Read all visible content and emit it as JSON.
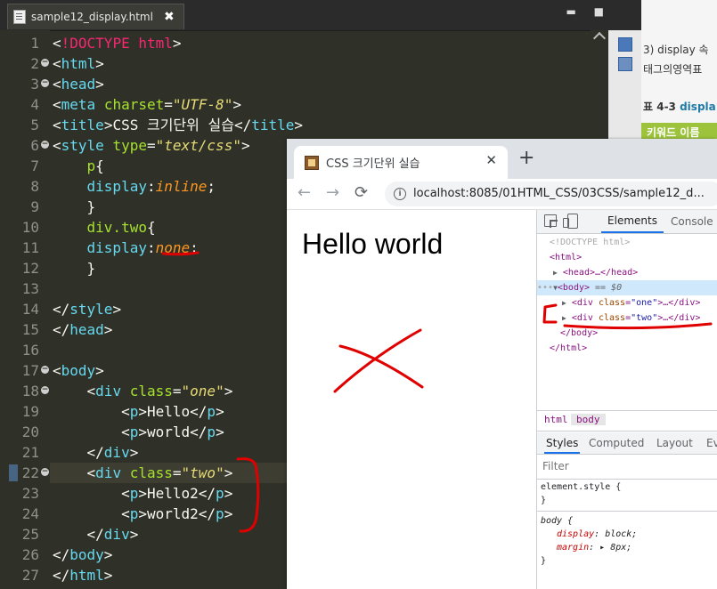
{
  "editor": {
    "tab_title": "sample12_display.html",
    "tab_close": "✖",
    "window_buttons": "▬ ■",
    "lines": [
      {
        "num": "1",
        "fold": false,
        "tokens": [
          {
            "c": "c-br",
            "t": "<"
          },
          {
            "c": "c-kw",
            "t": "!DOCTYPE"
          },
          {
            "c": "c-text",
            "t": " "
          },
          {
            "c": "c-kw",
            "t": "html"
          },
          {
            "c": "c-br",
            "t": ">"
          }
        ]
      },
      {
        "num": "2",
        "fold": true,
        "tokens": [
          {
            "c": "c-br",
            "t": "<"
          },
          {
            "c": "c-tag",
            "t": "html"
          },
          {
            "c": "c-br",
            "t": ">"
          }
        ]
      },
      {
        "num": "3",
        "fold": true,
        "tokens": [
          {
            "c": "c-br",
            "t": "<"
          },
          {
            "c": "c-tag",
            "t": "head"
          },
          {
            "c": "c-br",
            "t": ">"
          }
        ]
      },
      {
        "num": "4",
        "fold": false,
        "tokens": [
          {
            "c": "c-br",
            "t": "<"
          },
          {
            "c": "c-tag",
            "t": "meta"
          },
          {
            "c": "c-text",
            "t": " "
          },
          {
            "c": "c-attr",
            "t": "charset"
          },
          {
            "c": "c-br",
            "t": "="
          },
          {
            "c": "c-str",
            "t": "\"UTF-8\""
          },
          {
            "c": "c-br",
            "t": ">"
          }
        ]
      },
      {
        "num": "5",
        "fold": false,
        "tokens": [
          {
            "c": "c-br",
            "t": "<"
          },
          {
            "c": "c-tag",
            "t": "title"
          },
          {
            "c": "c-br",
            "t": ">"
          },
          {
            "c": "c-text",
            "t": "CSS 크기단위 실습"
          },
          {
            "c": "c-br",
            "t": "</"
          },
          {
            "c": "c-tag",
            "t": "title"
          },
          {
            "c": "c-br",
            "t": ">"
          }
        ]
      },
      {
        "num": "6",
        "fold": true,
        "tokens": [
          {
            "c": "c-br",
            "t": "<"
          },
          {
            "c": "c-tag",
            "t": "style"
          },
          {
            "c": "c-text",
            "t": " "
          },
          {
            "c": "c-attr",
            "t": "type"
          },
          {
            "c": "c-br",
            "t": "="
          },
          {
            "c": "c-str",
            "t": "\"text/css\""
          },
          {
            "c": "c-br",
            "t": ">"
          }
        ]
      },
      {
        "num": "7",
        "fold": false,
        "tokens": [
          {
            "c": "c-text",
            "t": "    "
          },
          {
            "c": "c-sel",
            "t": "p"
          },
          {
            "c": "c-text",
            "t": "{"
          }
        ]
      },
      {
        "num": "8",
        "fold": false,
        "tokens": [
          {
            "c": "c-text",
            "t": "    "
          },
          {
            "c": "c-prop",
            "t": "display"
          },
          {
            "c": "c-text",
            "t": ":"
          },
          {
            "c": "c-val",
            "t": "inline"
          },
          {
            "c": "c-text",
            "t": ";"
          }
        ]
      },
      {
        "num": "9",
        "fold": false,
        "tokens": [
          {
            "c": "c-text",
            "t": "    }"
          }
        ]
      },
      {
        "num": "10",
        "fold": false,
        "tokens": [
          {
            "c": "c-text",
            "t": "    "
          },
          {
            "c": "c-sel",
            "t": "div.two"
          },
          {
            "c": "c-text",
            "t": "{"
          }
        ]
      },
      {
        "num": "11",
        "fold": false,
        "tokens": [
          {
            "c": "c-text",
            "t": "    "
          },
          {
            "c": "c-prop",
            "t": "display"
          },
          {
            "c": "c-text",
            "t": ":"
          },
          {
            "c": "c-val",
            "t": "none"
          },
          {
            "c": "c-text",
            "t": ";"
          }
        ]
      },
      {
        "num": "12",
        "fold": false,
        "tokens": [
          {
            "c": "c-text",
            "t": "    }"
          }
        ]
      },
      {
        "num": "13",
        "fold": false,
        "tokens": []
      },
      {
        "num": "14",
        "fold": false,
        "tokens": [
          {
            "c": "c-br",
            "t": "</"
          },
          {
            "c": "c-tag",
            "t": "style"
          },
          {
            "c": "c-br",
            "t": ">"
          }
        ]
      },
      {
        "num": "15",
        "fold": false,
        "tokens": [
          {
            "c": "c-br",
            "t": "</"
          },
          {
            "c": "c-tag",
            "t": "head"
          },
          {
            "c": "c-br",
            "t": ">"
          }
        ]
      },
      {
        "num": "16",
        "fold": false,
        "tokens": []
      },
      {
        "num": "17",
        "fold": true,
        "tokens": [
          {
            "c": "c-br",
            "t": "<"
          },
          {
            "c": "c-tag",
            "t": "body"
          },
          {
            "c": "c-br",
            "t": ">"
          }
        ]
      },
      {
        "num": "18",
        "fold": true,
        "tokens": [
          {
            "c": "c-text",
            "t": "    "
          },
          {
            "c": "c-br",
            "t": "<"
          },
          {
            "c": "c-tag",
            "t": "div"
          },
          {
            "c": "c-text",
            "t": " "
          },
          {
            "c": "c-attr",
            "t": "class"
          },
          {
            "c": "c-br",
            "t": "="
          },
          {
            "c": "c-str",
            "t": "\"one\""
          },
          {
            "c": "c-br",
            "t": ">"
          }
        ]
      },
      {
        "num": "19",
        "fold": false,
        "tokens": [
          {
            "c": "c-text",
            "t": "        "
          },
          {
            "c": "c-br",
            "t": "<"
          },
          {
            "c": "c-tag",
            "t": "p"
          },
          {
            "c": "c-br",
            "t": ">"
          },
          {
            "c": "c-text",
            "t": "Hello"
          },
          {
            "c": "c-br",
            "t": "</"
          },
          {
            "c": "c-tag",
            "t": "p"
          },
          {
            "c": "c-br",
            "t": ">"
          }
        ]
      },
      {
        "num": "20",
        "fold": false,
        "tokens": [
          {
            "c": "c-text",
            "t": "        "
          },
          {
            "c": "c-br",
            "t": "<"
          },
          {
            "c": "c-tag",
            "t": "p"
          },
          {
            "c": "c-br",
            "t": ">"
          },
          {
            "c": "c-text",
            "t": "world"
          },
          {
            "c": "c-br",
            "t": "</"
          },
          {
            "c": "c-tag",
            "t": "p"
          },
          {
            "c": "c-br",
            "t": ">"
          }
        ]
      },
      {
        "num": "21",
        "fold": false,
        "tokens": [
          {
            "c": "c-text",
            "t": "    "
          },
          {
            "c": "c-br",
            "t": "</"
          },
          {
            "c": "c-tag",
            "t": "div"
          },
          {
            "c": "c-br",
            "t": ">"
          }
        ]
      },
      {
        "num": "22",
        "fold": true,
        "current": true,
        "tokens": [
          {
            "c": "c-text",
            "t": "    "
          },
          {
            "c": "c-br",
            "t": "<"
          },
          {
            "c": "c-tag",
            "t": "div"
          },
          {
            "c": "c-text",
            "t": " "
          },
          {
            "c": "c-attr",
            "t": "class"
          },
          {
            "c": "c-br",
            "t": "="
          },
          {
            "c": "c-str",
            "t": "\"two\""
          },
          {
            "c": "c-br",
            "t": ">"
          }
        ]
      },
      {
        "num": "23",
        "fold": false,
        "tokens": [
          {
            "c": "c-text",
            "t": "        "
          },
          {
            "c": "c-br",
            "t": "<"
          },
          {
            "c": "c-tag",
            "t": "p"
          },
          {
            "c": "c-br",
            "t": ">"
          },
          {
            "c": "c-text",
            "t": "Hello2"
          },
          {
            "c": "c-br",
            "t": "</"
          },
          {
            "c": "c-tag",
            "t": "p"
          },
          {
            "c": "c-br",
            "t": ">"
          }
        ]
      },
      {
        "num": "24",
        "fold": false,
        "tokens": [
          {
            "c": "c-text",
            "t": "        "
          },
          {
            "c": "c-br",
            "t": "<"
          },
          {
            "c": "c-tag",
            "t": "p"
          },
          {
            "c": "c-br",
            "t": ">"
          },
          {
            "c": "c-text",
            "t": "world2"
          },
          {
            "c": "c-br",
            "t": "</"
          },
          {
            "c": "c-tag",
            "t": "p"
          },
          {
            "c": "c-br",
            "t": ">"
          }
        ]
      },
      {
        "num": "25",
        "fold": false,
        "tokens": [
          {
            "c": "c-text",
            "t": "    "
          },
          {
            "c": "c-br",
            "t": "</"
          },
          {
            "c": "c-tag",
            "t": "div"
          },
          {
            "c": "c-br",
            "t": ">"
          }
        ]
      },
      {
        "num": "26",
        "fold": false,
        "tokens": [
          {
            "c": "c-br",
            "t": "</"
          },
          {
            "c": "c-tag",
            "t": "body"
          },
          {
            "c": "c-br",
            "t": ">"
          }
        ]
      },
      {
        "num": "27",
        "fold": false,
        "tokens": [
          {
            "c": "c-br",
            "t": "</"
          },
          {
            "c": "c-tag",
            "t": "html"
          },
          {
            "c": "c-br",
            "t": ">"
          }
        ]
      }
    ]
  },
  "document": {
    "line1": "3) display 속",
    "line2": "태그의영역표",
    "table_title_prefix": "표 4-3",
    "table_title_rest": "displa",
    "table_header": "키워드 이름"
  },
  "browser": {
    "tab_title": "CSS 크기단위 실습",
    "tab_close": "✕",
    "new_tab": "+",
    "back": "←",
    "forward": "→",
    "reload": "⟳",
    "info": "i",
    "url": "localhost:8085/01HTML_CSS/03CSS/sample12_d...",
    "zoom": "🔍",
    "page_text": "Hello world"
  },
  "devtools": {
    "tab_elements": "Elements",
    "tab_console": "Console",
    "dom": {
      "doctype": "<!DOCTYPE html>",
      "html_open": "<html>",
      "head_text": "<head>…</head>",
      "body_open": "<body>",
      "body_eq": " == $0",
      "dots": "•••",
      "div_one_tag": "<div ",
      "div_one_attr": "class",
      "div_one_val": "\"one\"",
      "div_one_end": ">…</div>",
      "div_two_tag": "<div ",
      "div_two_attr": "class",
      "div_two_val": "\"two\"",
      "div_two_end": ">…</div>",
      "body_close": "</body>",
      "html_close": "</html>"
    },
    "crumbs": [
      "html",
      "body"
    ],
    "subtabs": [
      "Styles",
      "Computed",
      "Layout",
      "Ev"
    ],
    "filter_placeholder": "Filter",
    "styles": {
      "element_style": "element.style {",
      "close1": "}",
      "body_sel": "body {",
      "prop1": "display",
      "val1": "block;",
      "prop2": "margin",
      "val2": "▸ 8px;",
      "close2": "}"
    }
  },
  "colors": {
    "annotation_red": "#e00000",
    "editor_bg": "#2f3129",
    "devtools_accent": "#1a73e8"
  }
}
